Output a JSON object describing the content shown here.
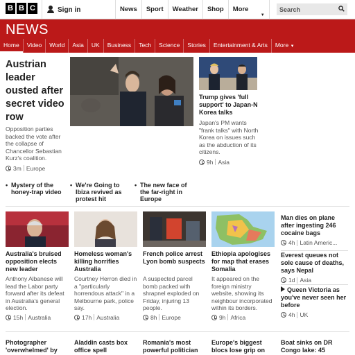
{
  "brand": {
    "logo_letters": [
      "B",
      "B",
      "C"
    ]
  },
  "signin": {
    "label": "Sign in"
  },
  "topnav": {
    "items": [
      "News",
      "Sport",
      "Weather",
      "Shop",
      "More"
    ]
  },
  "search": {
    "placeholder": "Search"
  },
  "section": {
    "title": "NEWS"
  },
  "newsnav": {
    "items": [
      "Home",
      "Video",
      "World",
      "Asia",
      "UK",
      "Business",
      "Tech",
      "Science",
      "Stories",
      "Entertainment & Arts",
      "More"
    ]
  },
  "lead": {
    "headline": "Austrian leader ousted after secret video row",
    "summary": "Opposition parties backed the vote after the collapse of Chancellor Sebastian Kurz's coalition.",
    "time": "3m",
    "region": "Europe"
  },
  "side": {
    "headline": "Trump gives 'full support' to Japan-N Korea talks",
    "summary": "Japan's PM wants \"frank talks\" with North Korea on issues such as the abduction of its citizens.",
    "time": "9h",
    "region": "Asia"
  },
  "bullets": [
    "Mystery of the honey-trap video",
    "We're Going to Ibiza revived as protest hit",
    "The new face of the far-right in Europe"
  ],
  "cards": [
    {
      "headline": "Australia's bruised opposition elects new leader",
      "summary": "Anthony Albanese will lead the Labor party forward after its defeat in Australia's general election.",
      "time": "15h",
      "region": "Australia"
    },
    {
      "headline": "Homeless woman's killing horrifies Australia",
      "summary": "Courtney Herron died in a \"particularly horrendous attack\" in a Melbourne park, police say.",
      "time": "17h",
      "region": "Australia"
    },
    {
      "headline": "French police arrest Lyon bomb suspects",
      "summary": "A suspected parcel bomb packed with shrapnel exploded on Friday, injuring 13 people.",
      "time": "8h",
      "region": "Europe"
    },
    {
      "headline": "Ethiopia apologises for map that erases Somalia",
      "summary": "It appeared on the foreign ministry website, showing its neighbour incorporated within its borders.",
      "time": "9h",
      "region": "Africa"
    }
  ],
  "right_col": [
    {
      "headline": "Man dies on plane after ingesting 246 cocaine bags",
      "time": "4h",
      "region": "Latin Americ..."
    },
    {
      "headline": "Everest queues not sole cause of deaths, says Nepal",
      "time": "1d",
      "region": "Asia"
    },
    {
      "headline": "Queen Victoria as you've never seen her before",
      "time": "4h",
      "region": "UK",
      "video": true
    }
  ],
  "bottom": [
    "Photographer 'overwhelmed' by",
    "Aladdin casts box office spell",
    "Romania's most powerful politician",
    "Europe's biggest blocs lose grip on",
    "Boat sinks on DR Congo lake: 45"
  ],
  "colors": {
    "brand_red": "#bb1919"
  }
}
